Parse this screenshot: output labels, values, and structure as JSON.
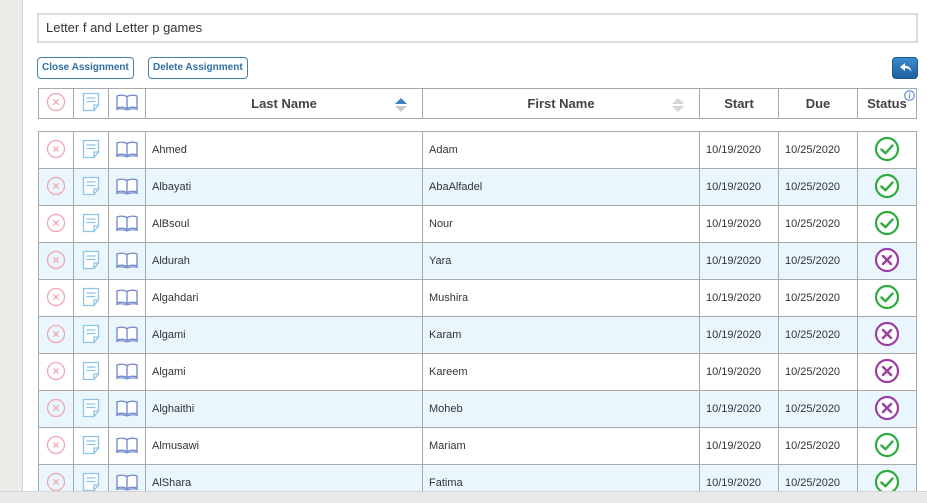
{
  "assignment": {
    "title": "Letter f and Letter p games"
  },
  "toolbar": {
    "close_label": "Close Assignment",
    "delete_label": "Delete Assignment",
    "back_icon": "back-arrow-icon"
  },
  "columns": {
    "last_name": "Last Name",
    "first_name": "First Name",
    "start": "Start",
    "due": "Due",
    "status": "Status"
  },
  "colors": {
    "accent": "#3d7fb3",
    "sort_active": "#3a84c4",
    "complete": "#2eab3f",
    "incomplete": "#9b3f9e",
    "remove": "#f2a6b4",
    "row_alt": "#eaf6fd"
  },
  "rows": [
    {
      "last": "Ahmed",
      "first": "Adam",
      "start": "10/19/2020",
      "due": "10/25/2020",
      "status": "complete"
    },
    {
      "last": "Albayati",
      "first": "AbaAlfadel",
      "start": "10/19/2020",
      "due": "10/25/2020",
      "status": "complete"
    },
    {
      "last": "AlBsoul",
      "first": "Nour",
      "start": "10/19/2020",
      "due": "10/25/2020",
      "status": "complete"
    },
    {
      "last": "Aldurah",
      "first": "Yara",
      "start": "10/19/2020",
      "due": "10/25/2020",
      "status": "incomplete"
    },
    {
      "last": "Algahdari",
      "first": "Mushira",
      "start": "10/19/2020",
      "due": "10/25/2020",
      "status": "complete"
    },
    {
      "last": "Algami",
      "first": "Karam",
      "start": "10/19/2020",
      "due": "10/25/2020",
      "status": "incomplete"
    },
    {
      "last": "Algami",
      "first": "Kareem",
      "start": "10/19/2020",
      "due": "10/25/2020",
      "status": "incomplete"
    },
    {
      "last": "Alghaithi",
      "first": "Moheb",
      "start": "10/19/2020",
      "due": "10/25/2020",
      "status": "incomplete"
    },
    {
      "last": "Almusawi",
      "first": "Mariam",
      "start": "10/19/2020",
      "due": "10/25/2020",
      "status": "complete"
    },
    {
      "last": "AlShara",
      "first": "Fatima",
      "start": "10/19/2020",
      "due": "10/25/2020",
      "status": "complete"
    }
  ]
}
